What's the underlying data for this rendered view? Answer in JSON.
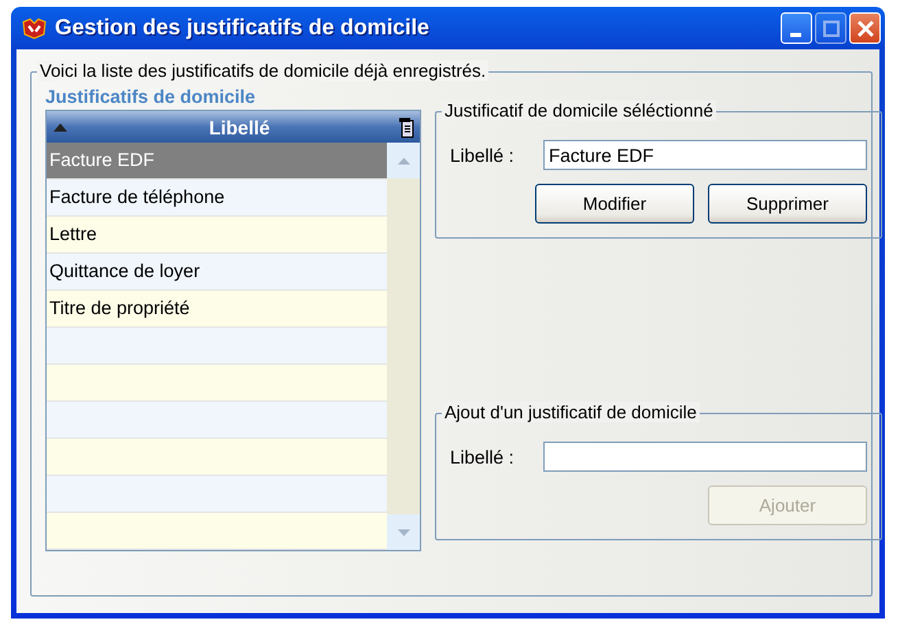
{
  "window": {
    "title": "Gestion des justificatifs de domicile",
    "controls": [
      {
        "kind": "minimize",
        "disabled": false
      },
      {
        "kind": "maximize",
        "disabled": true
      },
      {
        "kind": "close",
        "disabled": false
      }
    ]
  },
  "list_group": {
    "legend": "Voici la liste des justificatifs de domicile déjà enregistrés.",
    "table_title": "Justificatifs de domicile",
    "table": {
      "column": "Libellé",
      "rows": [
        {
          "label": "Facture EDF",
          "selected": true
        },
        {
          "label": "Facture de téléphone",
          "selected": false
        },
        {
          "label": "Lettre",
          "selected": false
        },
        {
          "label": "Quittance de loyer",
          "selected": false
        },
        {
          "label": "Titre de propriété",
          "selected": false
        }
      ]
    }
  },
  "selected_group": {
    "legend": "Justificatif de domicile séléctionné",
    "field": {
      "label": "Libellé :",
      "value": "Facture EDF"
    },
    "buttons": [
      {
        "label": "Modifier",
        "disabled": false
      },
      {
        "label": "Supprimer",
        "disabled": false
      }
    ]
  },
  "add_group": {
    "legend": "Ajout d'un justificatif de domicile",
    "field": {
      "label": "Libellé :"
    },
    "buttons": [
      {
        "label": "Ajouter",
        "disabled": true
      }
    ]
  }
}
